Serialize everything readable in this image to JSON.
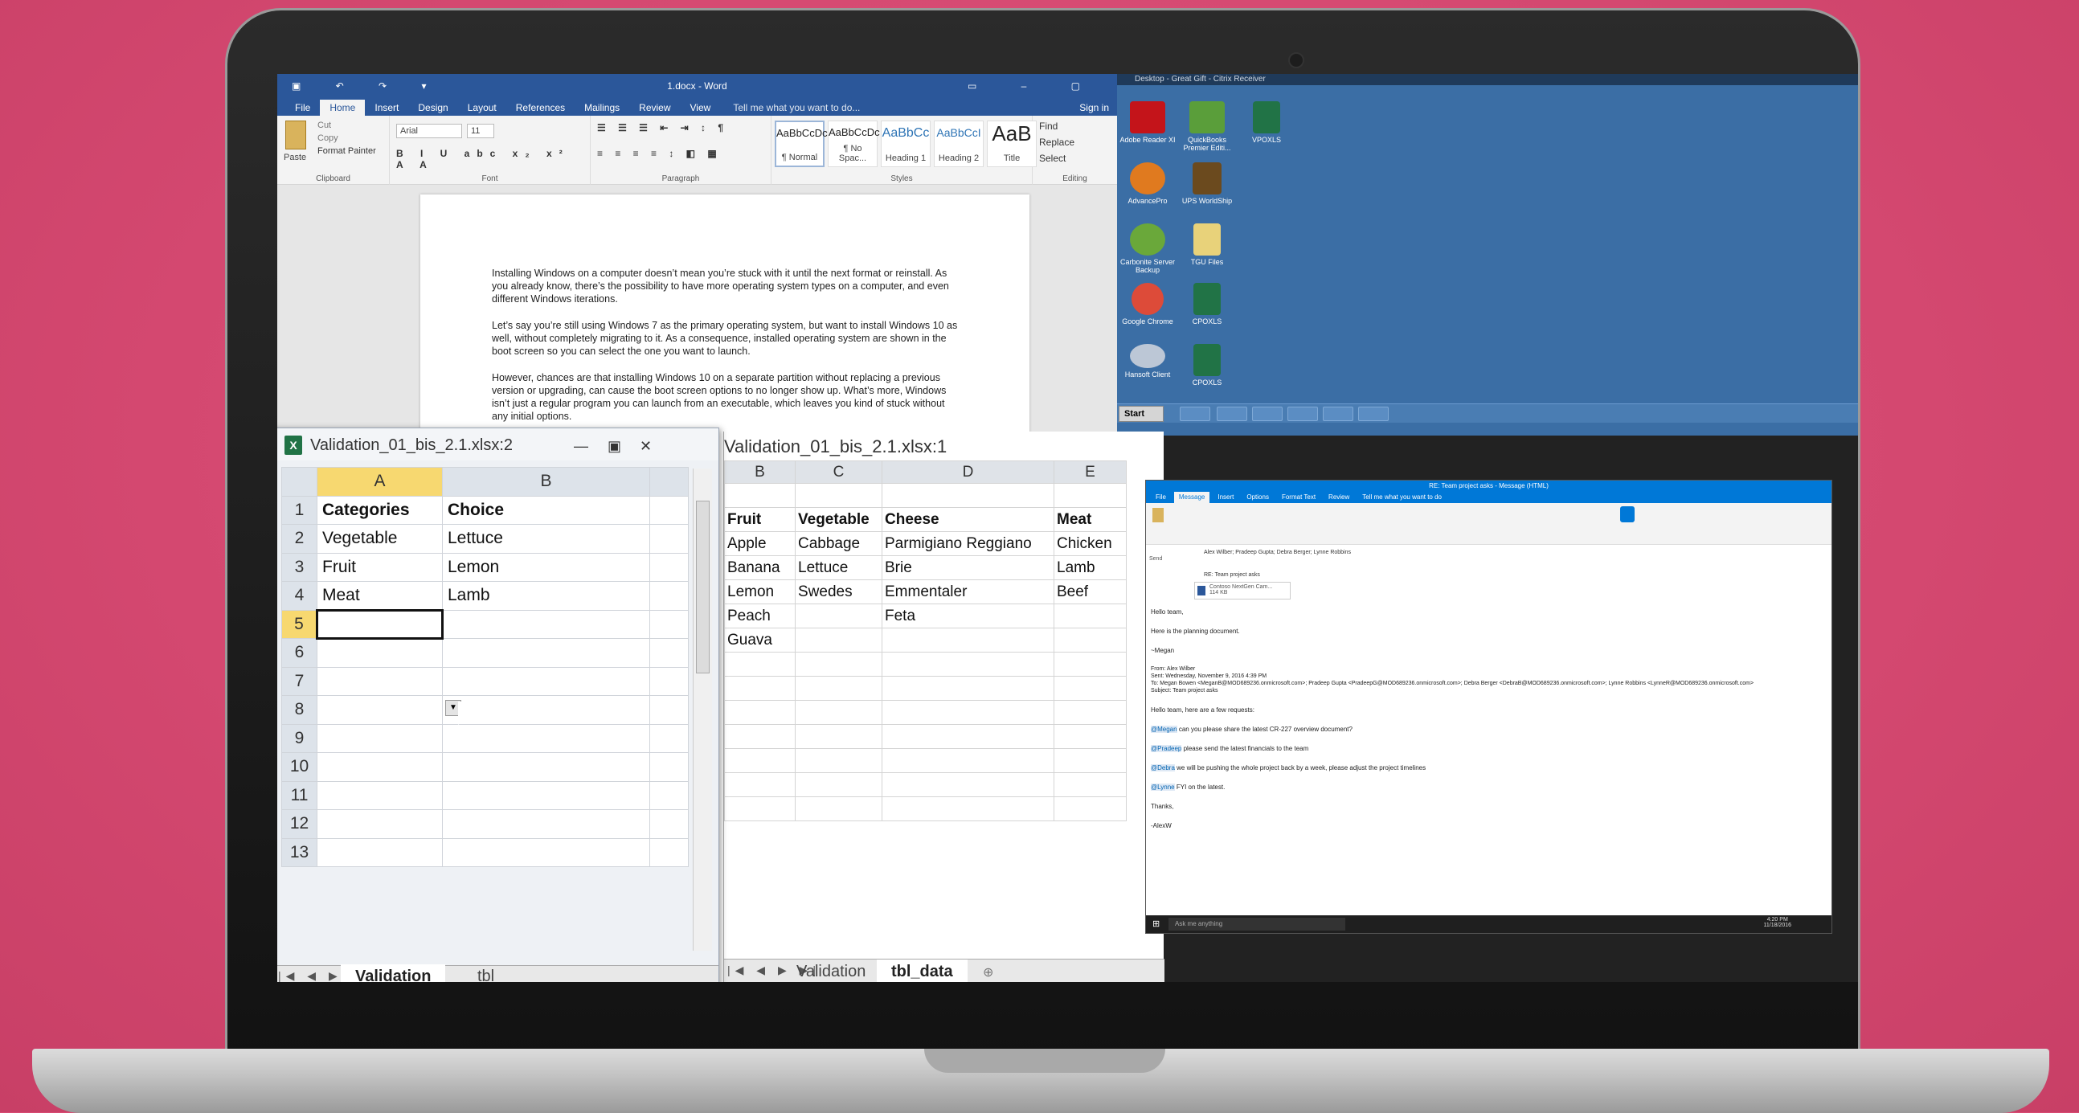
{
  "word": {
    "title": "1.docx - Word",
    "tabs": [
      "File",
      "Home",
      "Insert",
      "Design",
      "Layout",
      "References",
      "Mailings",
      "Review",
      "View"
    ],
    "tell_me": "Tell me what you want to do...",
    "sign_in": "Sign in",
    "clipboard": {
      "paste": "Paste",
      "cut": "Cut",
      "copy": "Copy",
      "format_painter": "Format Painter",
      "label": "Clipboard"
    },
    "font": {
      "name": "Arial",
      "size": "11",
      "label": "Font"
    },
    "paragraph_label": "Paragraph",
    "styles": [
      {
        "preview": "AaBbCcDc",
        "name": "¶ Normal"
      },
      {
        "preview": "AaBbCcDc",
        "name": "¶ No Spac..."
      },
      {
        "preview": "AaBbCc",
        "name": "Heading 1"
      },
      {
        "preview": "AaBbCcI",
        "name": "Heading 2"
      },
      {
        "preview": "AaB",
        "name": "Title"
      }
    ],
    "styles_label": "Styles",
    "editing": {
      "find": "Find",
      "replace": "Replace",
      "select": "Select",
      "label": "Editing"
    },
    "paragraphs": [
      "Installing Windows on a computer doesn’t mean you’re stuck with it until the next format or reinstall. As you already know, there’s the possibility to have more operating system types on a computer, and even different Windows iterations.",
      "Let’s say you’re still using Windows 7 as the primary operating system, but want to install Windows 10 as well, without completely migrating to it. As a consequence, installed operating system are shown in the boot screen so you can select the one you want to launch.",
      "However, chances are that installing Windows 10 on a separate partition without replacing a previous version or upgrading, can cause the boot screen options to no longer show up. What’s more, Windows isn’t just a regular program you can launch from an executable, which leaves you kind of stuck without any initial options."
    ]
  },
  "citrix": {
    "title": "Desktop - Great Gift - Citrix Receiver",
    "icons": [
      {
        "label": "Adobe Reader XI",
        "color": "#c4141a"
      },
      {
        "label": "QuickBooks Premier Editi...",
        "color": "#5a9e3a"
      },
      {
        "label": "VPOXLS",
        "color": "#217346"
      },
      {
        "label": "AdvancePro",
        "color": "#e07a1f"
      },
      {
        "label": "UPS WorldShip",
        "color": "#6b4a1e"
      },
      {
        "label": "Carbonite Server Backup",
        "color": "#6aa83a"
      },
      {
        "label": "TGU Files",
        "color": "#e8d27a"
      },
      {
        "label": "Google Chrome",
        "color": "#dd4b39"
      },
      {
        "label": "CPOXLS",
        "color": "#217346"
      },
      {
        "label": "Hansoft Client",
        "color": "#bcc7d6"
      },
      {
        "label": "CPOXLS",
        "color": "#217346"
      }
    ],
    "start": "Start"
  },
  "excel_small": {
    "title": "Validation_01_bis_2.1.xlsx:2",
    "columns": [
      "A",
      "B"
    ],
    "rows": [
      {
        "n": "1",
        "a": "Categories",
        "b": "Choice"
      },
      {
        "n": "2",
        "a": "Vegetable",
        "b": "Lettuce"
      },
      {
        "n": "3",
        "a": "Fruit",
        "b": "Lemon"
      },
      {
        "n": "4",
        "a": "Meat",
        "b": "Lamb"
      },
      {
        "n": "5",
        "a": "",
        "b": ""
      },
      {
        "n": "6",
        "a": "",
        "b": ""
      },
      {
        "n": "7",
        "a": "",
        "b": ""
      },
      {
        "n": "8",
        "a": "",
        "b": ""
      },
      {
        "n": "9",
        "a": "",
        "b": ""
      },
      {
        "n": "10",
        "a": "",
        "b": ""
      },
      {
        "n": "11",
        "a": "",
        "b": ""
      },
      {
        "n": "12",
        "a": "",
        "b": ""
      },
      {
        "n": "13",
        "a": "",
        "b": ""
      }
    ],
    "sheet_tabs": [
      "Validation",
      "tbl"
    ]
  },
  "excel_big": {
    "title": "Validation_01_bis_2.1.xlsx:1",
    "columns": [
      "B",
      "C",
      "D",
      "E"
    ],
    "header_row": [
      "Fruit",
      "Vegetable",
      "Cheese",
      "Meat"
    ],
    "rows": [
      [
        "Apple",
        "Cabbage",
        "Parmigiano Reggiano",
        "Chicken"
      ],
      [
        "Banana",
        "Lettuce",
        "Brie",
        "Lamb"
      ],
      [
        "Lemon",
        "Swedes",
        "Emmentaler",
        "Beef"
      ],
      [
        "Peach",
        "",
        "Feta",
        ""
      ],
      [
        "Guava",
        "",
        "",
        ""
      ]
    ],
    "sheet_tabs": [
      "Validation",
      "tbl_data"
    ]
  },
  "outlook": {
    "title": "RE: Team project asks  -  Message (HTML)",
    "tabs": [
      "File",
      "Message",
      "Insert",
      "Options",
      "Format Text",
      "Review"
    ],
    "tell_me": "Tell me what you want to do",
    "to": "Alex Wilber; Pradeep Gupta; Debra Berger; Lynne Robbins",
    "subject": "RE: Team project asks",
    "attachment": "Contoso NextGen Cam...",
    "attachment_size": "114 KB",
    "body": [
      "Hello team,",
      "Here is the planning document.",
      "~Megan"
    ],
    "from": "From: Alex Wilber",
    "sent": "Sent: Wednesday, November 9, 2016 4:39 PM",
    "to_line": "To: Megan Bowen <MeganB@MOD689236.onmicrosoft.com>; Pradeep Gupta <PradeepG@MOD689236.onmicrosoft.com>; Debra Berger <DebraB@MOD689236.onmicrosoft.com>; Lynne Robbins <LynneR@MOD689236.onmicrosoft.com>",
    "subject_line": "Subject: Team project asks",
    "greeting": "Hello team, here are a few requests:",
    "requests": [
      {
        "mention": "@Megan",
        "text": " can you please share the latest CR-227 overview document?"
      },
      {
        "mention": "@Pradeep",
        "text": " please send the latest financials to the team"
      },
      {
        "mention": "@Debra",
        "text": " we will be pushing the whole project back by a week, please adjust the project timelines"
      },
      {
        "mention": "@Lynne",
        "text": " FYI on the latest."
      }
    ],
    "closing": "Thanks,",
    "signature": "-AlexW",
    "search": "Ask me anything",
    "time": "4:20 PM",
    "date": "11/18/2016"
  }
}
